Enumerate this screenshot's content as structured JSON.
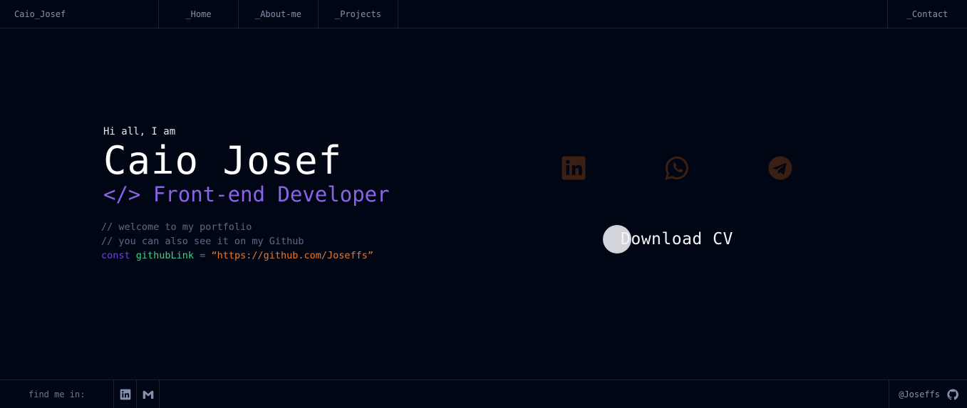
{
  "nav": {
    "brand": "Caio_Josef",
    "items": [
      {
        "label": "_Home"
      },
      {
        "label": "_About-me"
      },
      {
        "label": "_Projects"
      }
    ],
    "contact": "_Contact"
  },
  "hero": {
    "greeting": "Hi all, I am",
    "name": "Caio Josef",
    "role": "</> Front-end Developer",
    "comment1": "// welcome to my portfolio",
    "comment2": "// you can also see it on my Github",
    "code": {
      "keyword": "const",
      "variable": "githubLink",
      "equals": "=",
      "value": "“https://github.com/Joseffs”"
    }
  },
  "social": {
    "icons": [
      "linkedin-icon",
      "whatsapp-icon",
      "telegram-icon"
    ],
    "icon_color": "#3a1f12"
  },
  "download": {
    "label": "Download CV"
  },
  "footer": {
    "find_label": "find me in:",
    "icons": [
      "linkedin-icon",
      "gmail-icon"
    ],
    "github_handle": "@Joseffs",
    "github_icon": "github-icon"
  },
  "colors": {
    "background": "#010614",
    "accent_purple": "#8a63e6",
    "string_orange": "#e8792e",
    "variable_green": "#3fcf8e"
  }
}
